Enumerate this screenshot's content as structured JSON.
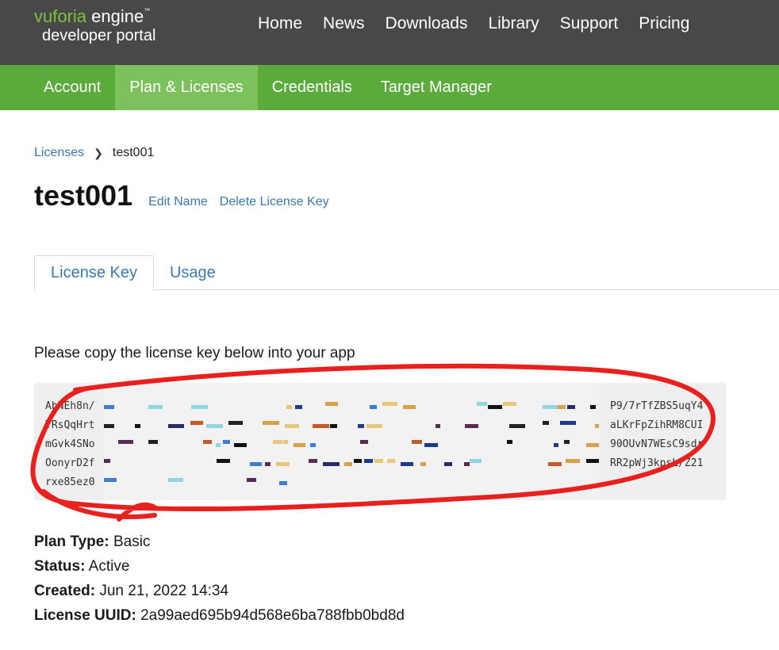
{
  "brand": {
    "vuforia": "vuforia",
    "engine": " engine",
    "tm": "™",
    "sub": "developer portal"
  },
  "top_nav": [
    "Home",
    "News",
    "Downloads",
    "Library",
    "Support",
    "Pricing"
  ],
  "sub_nav": [
    "Account",
    "Plan & Licenses",
    "Credentials",
    "Target Manager"
  ],
  "breadcrumb": {
    "parent": "Licenses",
    "current": "test001"
  },
  "page": {
    "title": "test001",
    "edit_link": "Edit Name",
    "delete_link": "Delete License Key"
  },
  "tabs": [
    "License Key",
    "Usage"
  ],
  "instruction": "Please copy the license key below into your app",
  "key_lines": [
    {
      "left": "AbNEh8n/",
      "right": "P9/7rTfZBS5uqY4"
    },
    {
      "left": "TRsQqHrt",
      "right": "aLKrFpZihRM8CUI"
    },
    {
      "left": "mGvk4SNo",
      "right": "90OUvN7WEsC9sdr"
    },
    {
      "left": "OonyrD2f",
      "right": "RR2pWj3kpsL/Z21"
    },
    {
      "left": "rxe85ez0",
      "right": ""
    }
  ],
  "details": {
    "plan_type_label": "Plan Type:",
    "plan_type": "Basic",
    "status_label": "Status:",
    "status": "Active",
    "created_label": "Created:",
    "created": "Jun 21, 2022 14:34",
    "uuid_label": "License UUID:",
    "uuid": "2a99aed695b94d568e6ba788fbb0bd8d"
  },
  "colors": {
    "topbar": "#484848",
    "green": "#5aab3c",
    "green_active": "#7cc15c",
    "link": "#3a78b0",
    "annotation": "#e8201e"
  }
}
